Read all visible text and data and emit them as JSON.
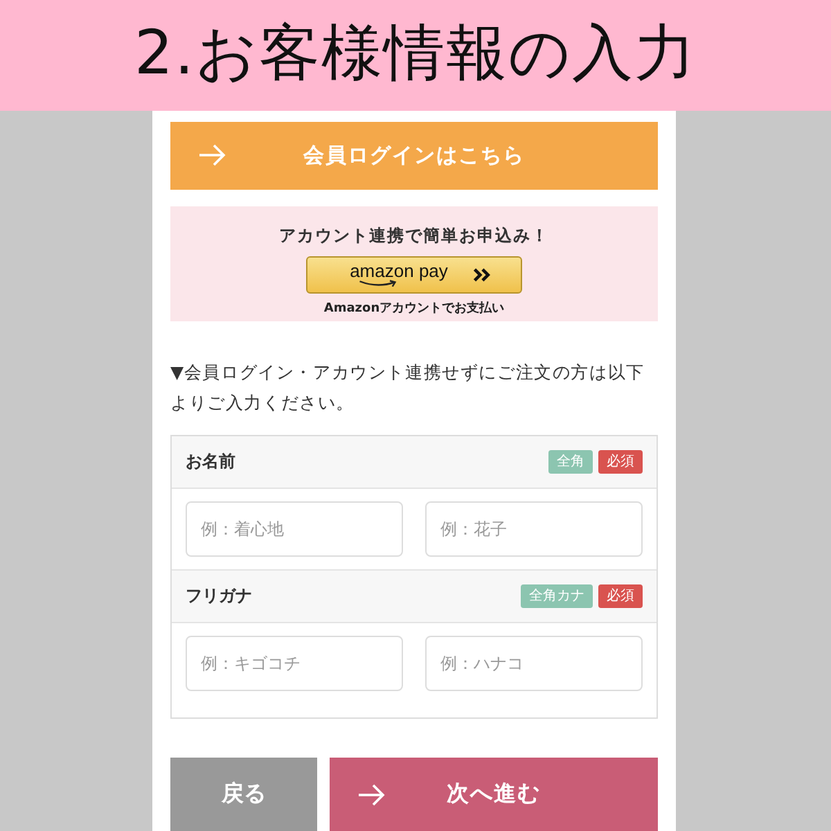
{
  "header": {
    "title": "2.お客様情報の入力"
  },
  "member_login_button": {
    "label": "会員ログインはこちら"
  },
  "account_link": {
    "heading": "アカウント連携で簡単お申込み！",
    "pay_button": {
      "label": "amazon pay"
    },
    "caption": "Amazonアカウントでお支払い"
  },
  "notice": "▼会員ログイン・アカウント連携せずにご注文の方は以下よりご入力ください。",
  "form": {
    "fields": [
      {
        "label": "お名前",
        "badges": [
          {
            "text": "全角",
            "kind": "format"
          },
          {
            "text": "必須",
            "kind": "required"
          }
        ],
        "inputs": [
          {
            "placeholder": "例：着心地"
          },
          {
            "placeholder": "例：花子"
          }
        ]
      },
      {
        "label": "フリガナ",
        "badges": [
          {
            "text": "全角カナ",
            "kind": "format"
          },
          {
            "text": "必須",
            "kind": "required"
          }
        ],
        "inputs": [
          {
            "placeholder": "例：キゴコチ"
          },
          {
            "placeholder": "例：ハナコ"
          }
        ]
      }
    ]
  },
  "buttons": [
    {
      "label": "戻る",
      "kind": "back"
    },
    {
      "label": "次へ進む",
      "kind": "next"
    }
  ]
}
